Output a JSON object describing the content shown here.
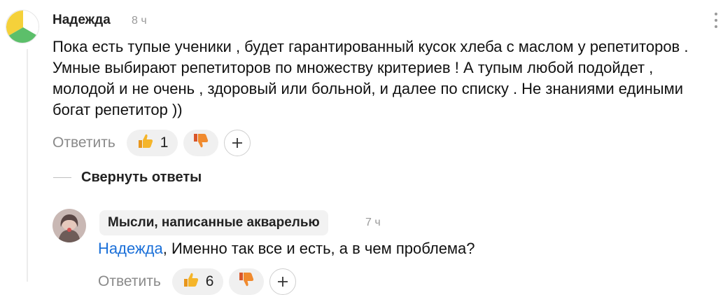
{
  "comment": {
    "author": "Надежда",
    "time": "8 ч",
    "text": "Пока есть тупые ученики , будет гарантированный кусок хлеба с маслом у репетиторов . Умные выбирают репетиторов по множеству критериев ! А тупым любой подойдет , молодой и не очень , здоровый или больной, и далее по списку . Не знаниями едиными богат репетитор ))",
    "reply_label": "Ответить",
    "likes": "1",
    "icons": {
      "like": "thumbs-up-icon",
      "dislike": "thumbs-down-icon",
      "add_reaction": "plus-icon",
      "menu": "more-vertical-icon"
    }
  },
  "collapse_label": "Свернуть ответы",
  "reply": {
    "author": "Мысли, написанные акварелью",
    "time": "7 ч",
    "mention": "Надежда",
    "text": ", Именно так все и есть, а в чем проблема?",
    "reply_label": "Ответить",
    "likes": "6"
  },
  "colors": {
    "accent": "#1a6fd8",
    "avatar_yellow": "#f5d13a",
    "avatar_green": "#5cbf6a",
    "muted": "#8a8a8a"
  }
}
